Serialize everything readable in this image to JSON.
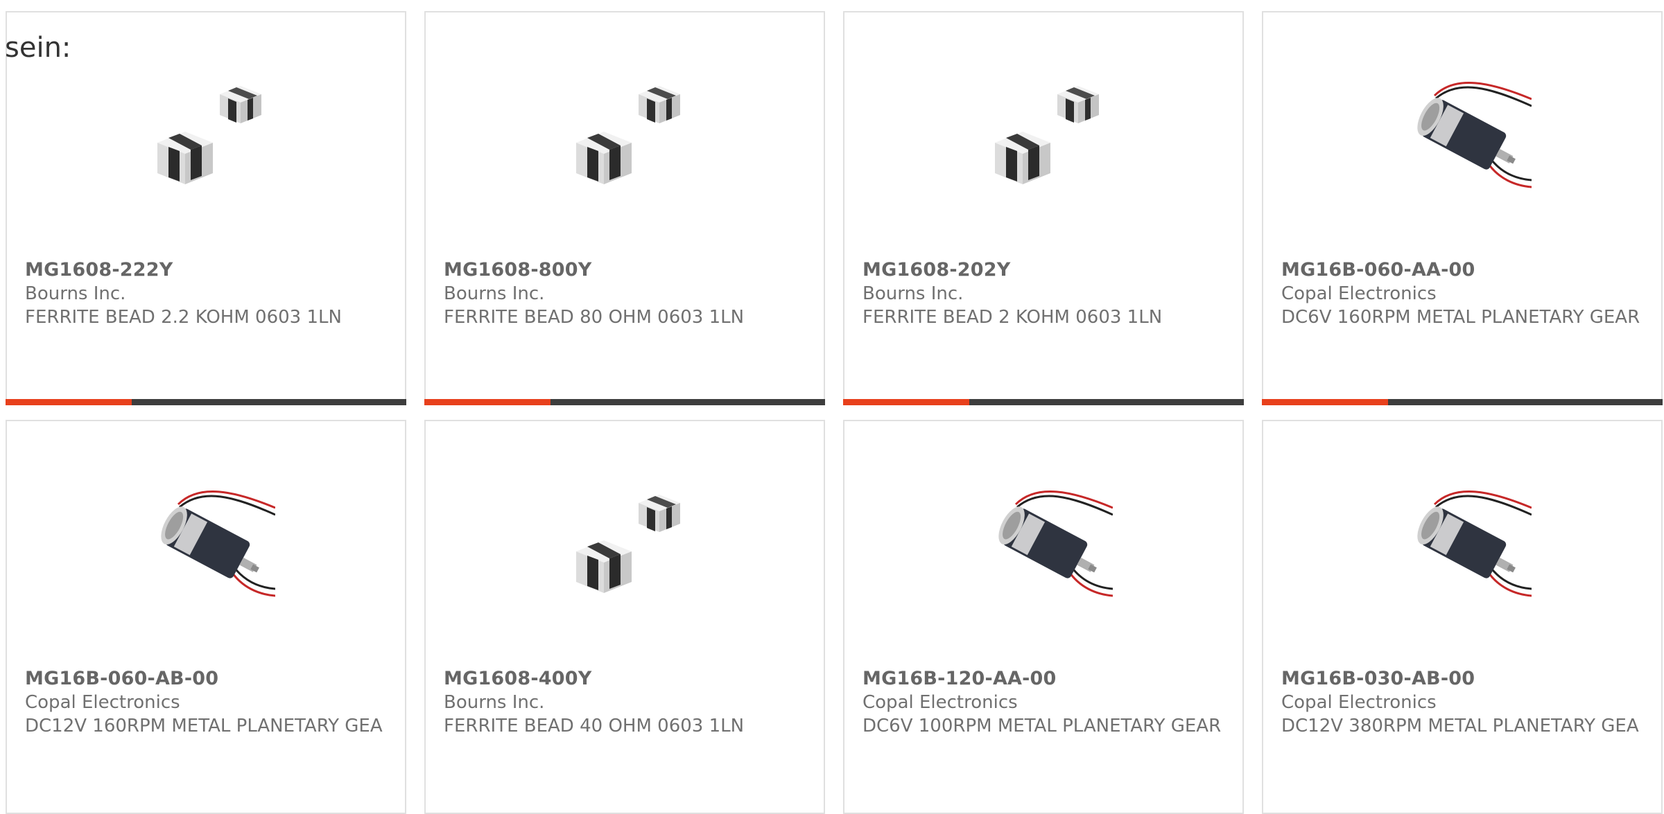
{
  "heading": "sein:",
  "colors": {
    "accent": "#e8401c",
    "bar": "#3d3d3d",
    "border": "#e0e0e0",
    "text": "#707070"
  },
  "products": [
    {
      "part_number": "MG1608-222Y",
      "manufacturer": "Bourns Inc.",
      "description": "FERRITE BEAD 2.2 KOHM 0603 1LN",
      "image": "ferrite-bead-icon"
    },
    {
      "part_number": "MG1608-800Y",
      "manufacturer": "Bourns Inc.",
      "description": "FERRITE BEAD 80 OHM 0603 1LN",
      "image": "ferrite-bead-icon"
    },
    {
      "part_number": "MG1608-202Y",
      "manufacturer": "Bourns Inc.",
      "description": "FERRITE BEAD 2 KOHM 0603 1LN",
      "image": "ferrite-bead-icon"
    },
    {
      "part_number": "MG16B-060-AA-00",
      "manufacturer": "Copal Electronics",
      "description": "DC6V 160RPM METAL PLANETARY GEAR",
      "image": "gear-motor-icon"
    },
    {
      "part_number": "MG16B-060-AB-00",
      "manufacturer": "Copal Electronics",
      "description": "DC12V 160RPM METAL PLANETARY GEA",
      "image": "gear-motor-icon"
    },
    {
      "part_number": "MG1608-400Y",
      "manufacturer": "Bourns Inc.",
      "description": "FERRITE BEAD 40 OHM 0603 1LN",
      "image": "ferrite-bead-icon"
    },
    {
      "part_number": "MG16B-120-AA-00",
      "manufacturer": "Copal Electronics",
      "description": "DC6V 100RPM METAL PLANETARY GEAR",
      "image": "gear-motor-icon"
    },
    {
      "part_number": "MG16B-030-AB-00",
      "manufacturer": "Copal Electronics",
      "description": "DC12V 380RPM METAL PLANETARY GEA",
      "image": "gear-motor-icon"
    }
  ]
}
